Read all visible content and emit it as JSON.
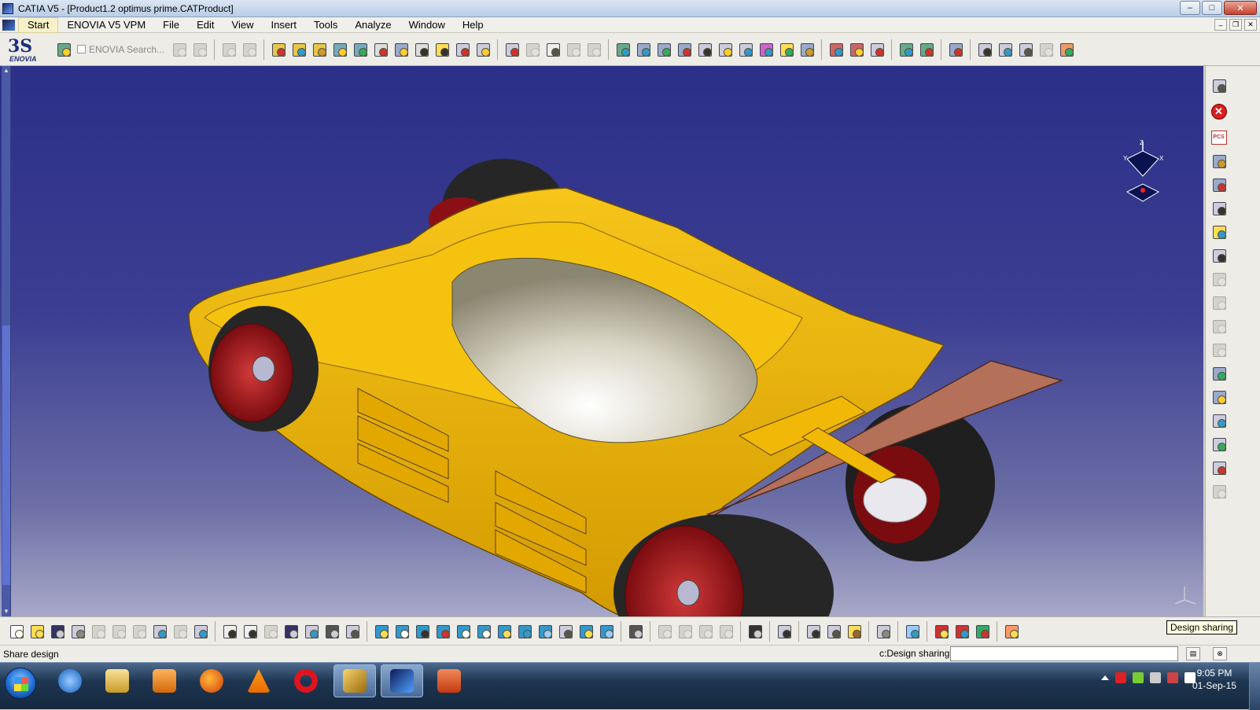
{
  "window": {
    "title": "CATIA V5 - [Product1.2 optimus prime.CATProduct]",
    "controls": {
      "minimize": "–",
      "maximize": "□",
      "close": "✕"
    }
  },
  "menubar": {
    "items": [
      "Start",
      "ENOVIA V5 VPM",
      "File",
      "Edit",
      "View",
      "Insert",
      "Tools",
      "Analyze",
      "Window",
      "Help"
    ],
    "mdi_controls": {
      "minimize": "–",
      "restore": "❐",
      "close": "✕"
    }
  },
  "top_toolbar": {
    "logo_text": "ENOVIA",
    "search_label": "ENOVIA Search..."
  },
  "right_toolbar": {
    "pcs_label": "PCS"
  },
  "viewport": {
    "compass_axes": {
      "z": "Z",
      "y": "Y",
      "x": "X"
    },
    "background_top": "#2c2f87",
    "background_bottom": "#a7a8c8",
    "model": {
      "body_color": "#f2b807",
      "wheel_rim_color": "#a01218",
      "tire_color": "#2a2a2a",
      "spoiler_color": "#b5705a",
      "cockpit_color": "#d8d4c4"
    }
  },
  "tooltip": "Design sharing",
  "statusbar": {
    "message": "Share design",
    "command_label": "c:Design sharing",
    "command_value": ""
  },
  "taskbar": {
    "apps": [
      "internet-explorer",
      "file-explorer",
      "media-player",
      "firefox",
      "vlc",
      "opera",
      "winamp",
      "catia",
      "powerpoint"
    ],
    "clock_time": "9:05 PM",
    "clock_date": "01-Sep-15"
  }
}
